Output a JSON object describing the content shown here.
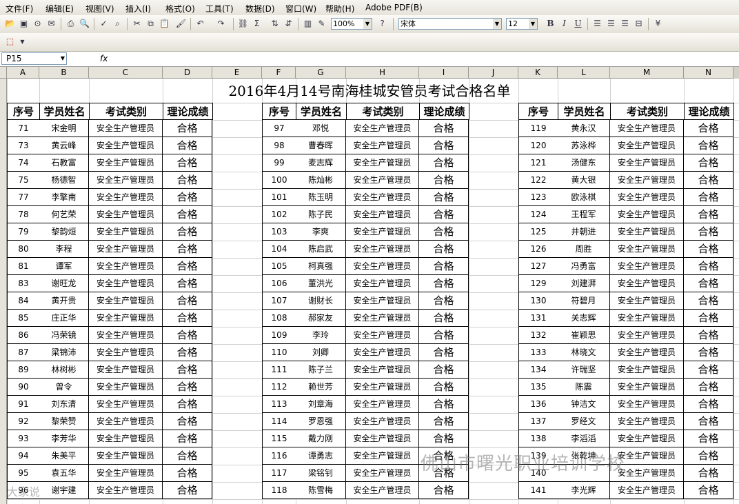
{
  "menu": [
    "文件(F)",
    "编辑(E)",
    "视图(V)",
    "插入(I)",
    "格式(O)",
    "工具(T)",
    "数据(D)",
    "窗口(W)",
    "帮助(H)",
    "Adobe PDF(B)"
  ],
  "toolbar": {
    "zoom": "100%",
    "font": "宋体",
    "size": "12",
    "bold": "B",
    "italic": "I",
    "underline": "U"
  },
  "formula": {
    "namebox": "P15",
    "fx": "fx",
    "value": ""
  },
  "columns": [
    "A",
    "B",
    "C",
    "D",
    "E",
    "F",
    "G",
    "H",
    "I",
    "J",
    "K",
    "L",
    "M",
    "N"
  ],
  "sheet": {
    "title": "2016年4月14号南海桂城安管员考试合格名单",
    "headers": [
      "序号",
      "学员姓名",
      "考试类别",
      "理论成绩"
    ],
    "left": [
      [
        "71",
        "宋金明",
        "安全生产管理员",
        "合格"
      ],
      [
        "73",
        "黄云峰",
        "安全生产管理员",
        "合格"
      ],
      [
        "74",
        "石教富",
        "安全生产管理员",
        "合格"
      ],
      [
        "75",
        "杨德智",
        "安全生产管理员",
        "合格"
      ],
      [
        "77",
        "李擎南",
        "安全生产管理员",
        "合格"
      ],
      [
        "78",
        "何艺荣",
        "安全生产管理员",
        "合格"
      ],
      [
        "79",
        "黎韵烜",
        "安全生产管理员",
        "合格"
      ],
      [
        "80",
        "李程",
        "安全生产管理员",
        "合格"
      ],
      [
        "81",
        "谭军",
        "安全生产管理员",
        "合格"
      ],
      [
        "83",
        "谢旺龙",
        "安全生产管理员",
        "合格"
      ],
      [
        "84",
        "黄开贵",
        "安全生产管理员",
        "合格"
      ],
      [
        "85",
        "庄正华",
        "安全生产管理员",
        "合格"
      ],
      [
        "86",
        "冯荣镜",
        "安全生产管理员",
        "合格"
      ],
      [
        "87",
        "梁锦沛",
        "安全生产管理员",
        "合格"
      ],
      [
        "89",
        "林树彬",
        "安全生产管理员",
        "合格"
      ],
      [
        "90",
        "曾令",
        "安全生产管理员",
        "合格"
      ],
      [
        "91",
        "刘东清",
        "安全生产管理员",
        "合格"
      ],
      [
        "92",
        "黎荣赞",
        "安全生产管理员",
        "合格"
      ],
      [
        "93",
        "李芳华",
        "安全生产管理员",
        "合格"
      ],
      [
        "94",
        "朱美平",
        "安全生产管理员",
        "合格"
      ],
      [
        "95",
        "袁五华",
        "安全生产管理员",
        "合格"
      ],
      [
        "96",
        "谢宇建",
        "安全生产管理员",
        "合格"
      ]
    ],
    "middle": [
      [
        "97",
        "邓悦",
        "安全生产管理员",
        "合格"
      ],
      [
        "98",
        "曹春晖",
        "安全生产管理员",
        "合格"
      ],
      [
        "99",
        "麦志辉",
        "安全生产管理员",
        "合格"
      ],
      [
        "100",
        "陈灿彬",
        "安全生产管理员",
        "合格"
      ],
      [
        "101",
        "陈玉明",
        "安全生产管理员",
        "合格"
      ],
      [
        "102",
        "陈子民",
        "安全生产管理员",
        "合格"
      ],
      [
        "103",
        "李爽",
        "安全生产管理员",
        "合格"
      ],
      [
        "104",
        "陈启武",
        "安全生产管理员",
        "合格"
      ],
      [
        "105",
        "柯真强",
        "安全生产管理员",
        "合格"
      ],
      [
        "106",
        "董洪光",
        "安全生产管理员",
        "合格"
      ],
      [
        "107",
        "谢财长",
        "安全生产管理员",
        "合格"
      ],
      [
        "108",
        "郝家友",
        "安全生产管理员",
        "合格"
      ],
      [
        "109",
        "李玲",
        "安全生产管理员",
        "合格"
      ],
      [
        "110",
        "刘卿",
        "安全生产管理员",
        "合格"
      ],
      [
        "111",
        "陈子兰",
        "安全生产管理员",
        "合格"
      ],
      [
        "112",
        "赖世芳",
        "安全生产管理员",
        "合格"
      ],
      [
        "113",
        "刘章海",
        "安全生产管理员",
        "合格"
      ],
      [
        "114",
        "罗恩强",
        "安全生产管理员",
        "合格"
      ],
      [
        "115",
        "戴力刚",
        "安全生产管理员",
        "合格"
      ],
      [
        "116",
        "谭勇志",
        "安全生产管理员",
        "合格"
      ],
      [
        "117",
        "梁铭钊",
        "安全生产管理员",
        "合格"
      ],
      [
        "118",
        "陈雪梅",
        "安全生产管理员",
        "合格"
      ]
    ],
    "right": [
      [
        "119",
        "黄永汉",
        "安全生产管理员",
        "合格"
      ],
      [
        "120",
        "苏泳桦",
        "安全生产管理员",
        "合格"
      ],
      [
        "121",
        "汤健东",
        "安全生产管理员",
        "合格"
      ],
      [
        "122",
        "黄大银",
        "安全生产管理员",
        "合格"
      ],
      [
        "123",
        "欧泳棋",
        "安全生产管理员",
        "合格"
      ],
      [
        "124",
        "王程军",
        "安全生产管理员",
        "合格"
      ],
      [
        "125",
        "井朝进",
        "安全生产管理员",
        "合格"
      ],
      [
        "126",
        "周胜",
        "安全生产管理员",
        "合格"
      ],
      [
        "127",
        "冯勇富",
        "安全生产管理员",
        "合格"
      ],
      [
        "129",
        "刘建湃",
        "安全生产管理员",
        "合格"
      ],
      [
        "130",
        "符碧月",
        "安全生产管理员",
        "合格"
      ],
      [
        "131",
        "关志辉",
        "安全生产管理员",
        "合格"
      ],
      [
        "132",
        "崔颖思",
        "安全生产管理员",
        "合格"
      ],
      [
        "133",
        "林晓文",
        "安全生产管理员",
        "合格"
      ],
      [
        "134",
        "许瑞坚",
        "安全生产管理员",
        "合格"
      ],
      [
        "135",
        "陈震",
        "安全生产管理员",
        "合格"
      ],
      [
        "136",
        "钟洁文",
        "安全生产管理员",
        "合格"
      ],
      [
        "137",
        "罗经文",
        "安全生产管理员",
        "合格"
      ],
      [
        "138",
        "李滔滔",
        "安全生产管理员",
        "合格"
      ],
      [
        "139",
        "张乾坤",
        "安全生产管理员",
        "合格"
      ],
      [
        "140",
        "",
        "安全生产管理员",
        "合格"
      ],
      [
        "141",
        "李光辉",
        "安全生产管理员",
        "合格"
      ]
    ]
  },
  "watermark": "佛山市曙光职业培训学校",
  "watermark2": "大家说"
}
